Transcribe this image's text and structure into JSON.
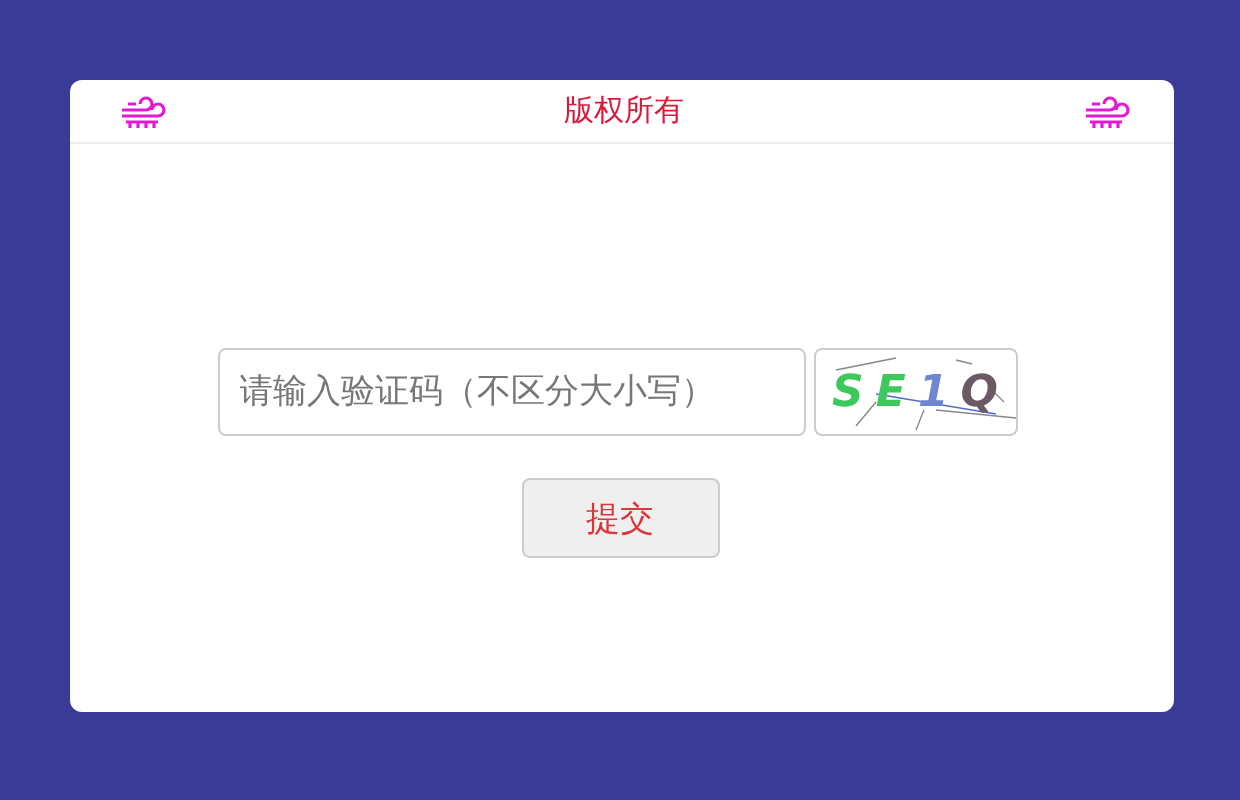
{
  "header": {
    "title": "版权所有"
  },
  "captcha_field": {
    "placeholder": "请输入验证码（不区分大小写）"
  },
  "captcha_image": {
    "characters": [
      {
        "char": "S",
        "color": "#3cc85a"
      },
      {
        "char": "E",
        "color": "#3cc85a"
      },
      {
        "char": "1",
        "color": "#6f86d0"
      },
      {
        "char": "Q",
        "color": "#6b5a66"
      }
    ]
  },
  "submit_button": {
    "label": "提交"
  }
}
